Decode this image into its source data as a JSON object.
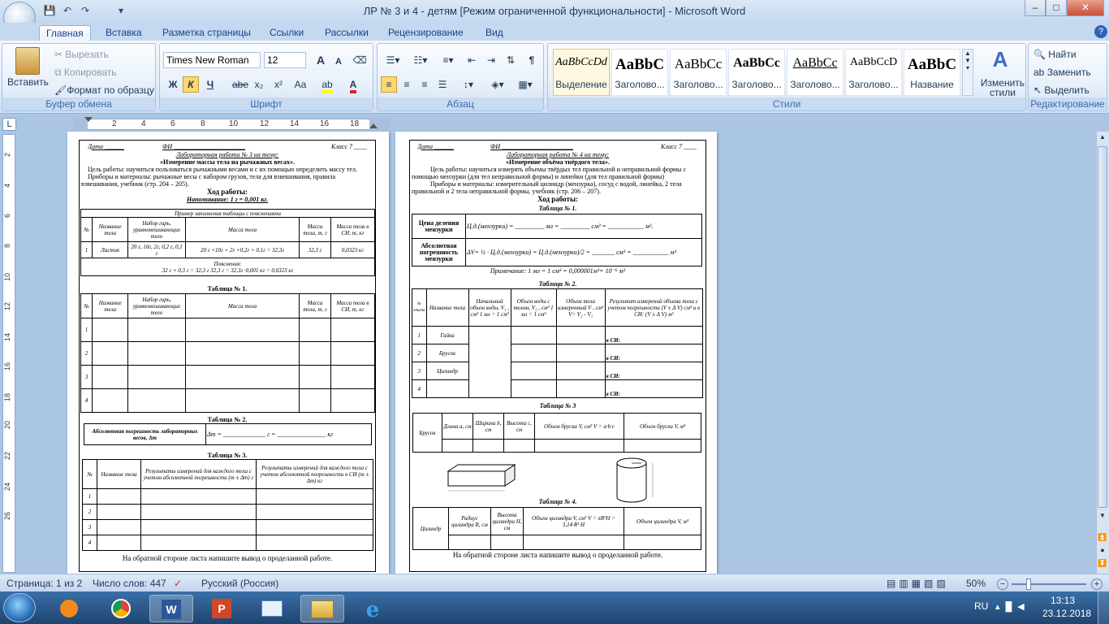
{
  "window": {
    "title": "ЛР № 3 и 4 - детям [Режим ограниченной функциональности] - Microsoft Word",
    "minimize": "–",
    "maximize": "□",
    "close": "✕"
  },
  "tabs": [
    "Главная",
    "Вставка",
    "Разметка страницы",
    "Ссылки",
    "Рассылки",
    "Рецензирование",
    "Вид"
  ],
  "clipboard": {
    "paste": "Вставить",
    "cut": "Вырезать",
    "copy": "Копировать",
    "format_painter": "Формат по образцу",
    "group": "Буфер обмена"
  },
  "font": {
    "family": "Times New Roman",
    "size": "12",
    "group": "Шрифт",
    "bold": "Ж",
    "italic": "К",
    "underline": "Ч",
    "strike": "abe",
    "sub": "x₂",
    "sup": "x²",
    "case": "Aa",
    "grow": "A",
    "shrink": "A"
  },
  "paragraph": {
    "group": "Абзац"
  },
  "styles": {
    "group": "Стили",
    "items": [
      {
        "sample": "AaBbCcDd",
        "name": "Выделение"
      },
      {
        "sample": "AaBbC",
        "name": "Заголово..."
      },
      {
        "sample": "AaBbCc",
        "name": "Заголово..."
      },
      {
        "sample": "AaBbCc",
        "name": "Заголово..."
      },
      {
        "sample": "AaBbCc",
        "name": "Заголово..."
      },
      {
        "sample": "AaBbCcD",
        "name": "Заголово..."
      },
      {
        "sample": "AaBbC",
        "name": "Название"
      }
    ],
    "change": "Изменить стили"
  },
  "editing": {
    "group": "Редактирование",
    "find": "Найти",
    "replace": "Заменить",
    "select": "Выделить"
  },
  "ruler": {
    "ticks": [
      "2",
      "4",
      "6",
      "8",
      "10",
      "12",
      "14",
      "16",
      "18"
    ]
  },
  "vruler": {
    "ticks": [
      "2",
      "4",
      "6",
      "8",
      "10",
      "12",
      "14",
      "16",
      "18",
      "20",
      "22",
      "24",
      "26"
    ]
  },
  "page1": {
    "header_date": "Дата ______",
    "header_fi": "ФИ ______________________",
    "header_class": "Класс  7 ____",
    "lab_title": "Лабораторная работа № 3 на тему:",
    "lab_topic": "«Измерение массы  тела на рычажных весах».",
    "goal": "Цель работы: научиться пользоваться рычажными весами и с их помощью определить массу тел.",
    "tools": "Приборы и материалы: рычажные весы с набором грузов,  тела для взвешивания, правила",
    "tools2": "взвешивания, учебник (стр. 204 – 205).",
    "progress": "Ход работы:",
    "hint": "Напоминание: 1 г = 0,001 кг.",
    "example_caption": "Пример заполнения таблицы с пояснениями",
    "cols": [
      "№",
      "Название тела",
      "Набор гирь, уравновешивающих тело",
      "Масса тела",
      "Масса тела, m, г",
      "Масса тела в СИ, m, кг"
    ],
    "example_row": [
      "1",
      "Ластик",
      "20 г, 10г, 2г, 0,2 г, 0,1 г",
      "20 г +10г + 2г +0,2г + 0,1г = 32,3г",
      "32,3 г",
      "0,0323 кг"
    ],
    "explain_title": "Пояснения:",
    "explain_text": "32 г + 0,3 г = 32,3 г               32,3 г = 32,3г ·0,001 кг = 0,0323 кг",
    "table1_caption": "Таблица № 1.",
    "rows": [
      "1",
      "2",
      "3",
      "4"
    ],
    "table2_caption": "Таблица № 2.",
    "abs_err": "Абсолютная погрешность лабораторных весов, Δm",
    "abs_err_formula": "Δm = _____________ г = _______________ кг",
    "table3_caption": "Таблица № 3.",
    "t3_cols": [
      "№",
      "Название тела",
      "Результаты измерений для каждого тела с учетом абсолютной погрешности (m ± Δm) г",
      "Результаты измерений для каждого тела с учетом абсолютной погрешности в СИ (m ± Δm) кг"
    ],
    "footer": "На обратной стороне листа напишите вывод о проделанной работе."
  },
  "page2": {
    "header_date": "Дата ______",
    "header_fi": "ФИ ______________________",
    "header_class": "Класс  7 ____",
    "lab_title": "Лабораторная работа № 4 на тему:",
    "lab_topic": "«Измерение объёма твёрдого тела».",
    "goal": "Цель работы:  научиться измерять объемы твёрдых тел правильной и неправильной формы с",
    "goal2": "помощью мензурки (для тел неправильной формы) и линейки (для тел правильной формы)",
    "tools": "Приборы и материалы: измерительный цилиндр (мензурка), сосуд с водой, линейка, 2 тела",
    "tools2": "правильной и 2 тела неправильной формы, учебник (стр. 206 – 207).",
    "progress": "Ход  работы:",
    "table1_caption": "Таблица № 1.",
    "price_label": "Цена деления мензурки",
    "price_formula": "Ц.д.(мензурки) = _________ мл = _________ см³ = ___________ м³.",
    "abs_label": "Абсолютная погрешность мензурки",
    "abs_formula": "ΔV= ½ · Ц.д.(мензурки) = Ц.д.(мензурки)/2 = _______ см³ = ___________ м³",
    "note": "Примечание: 1 мл = 1 см³  = 0,000001м³= 10⁻⁶ м³",
    "table2_caption": "Таблица № 2.",
    "t2_cols": [
      "№ опыта",
      "Название тела",
      "Начальный объем воды, V₁ , см³ 1 мл = 1 см³",
      "Объем воды с телом, V₂ , см³ 1 мл = 1 см³",
      "Объем тела измеренный V , см³ V= V₂ - V₁",
      "Результат измерений объема тела с учетом погрешности (V ± Δ V) см³ и в СИ: (V ± Δ V) м³"
    ],
    "t2_rows": [
      {
        "n": "1",
        "name": "Гайка"
      },
      {
        "n": "2",
        "name": "Брусок"
      },
      {
        "n": "3",
        "name": "Цилиндр"
      },
      {
        "n": "4",
        "name": ""
      }
    ],
    "si_label": "в СИ:",
    "table3_caption": "Таблица № 3",
    "t3_cols": [
      "Брусок",
      "Длина a, см",
      "Ширина b, см",
      "Высота c, см",
      "Объем бруска V, см³ V = a·b·c",
      "Объем бруска V, м³"
    ],
    "table4_caption": "Таблица № 4.",
    "t4_cols": [
      "Цилиндр",
      "Радиус цилиндра R, см",
      "Высота цилиндра H, см",
      "Объем цилиндра V, см³ V = πR²H = 3,14·R²·H",
      "Объем цилиндра V, м³"
    ],
    "footer": "На обратной стороне листа напишите вывод о проделанной работе."
  },
  "status": {
    "page": "Страница: 1 из 2",
    "words": "Число слов: 447",
    "lang": "Русский (Россия)",
    "zoom": "50%"
  },
  "taskbar": {
    "lang": "RU",
    "time": "13:13",
    "date": "23.12.2018"
  }
}
